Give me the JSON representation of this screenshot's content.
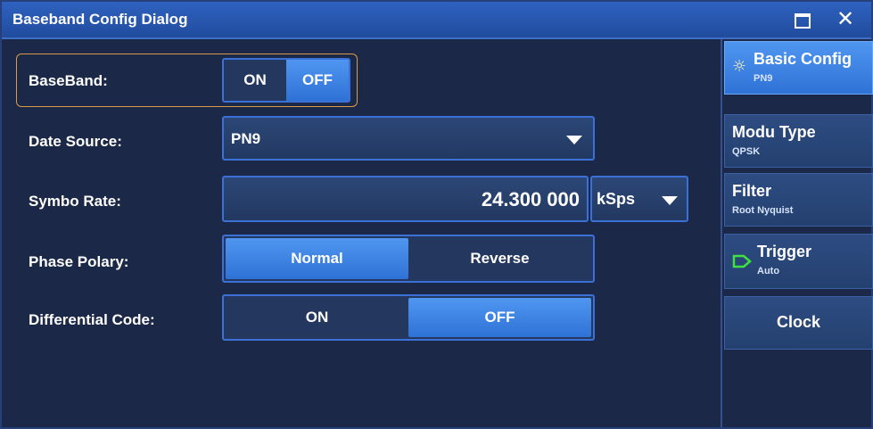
{
  "window": {
    "title": "Baseband Config Dialog"
  },
  "fields": {
    "baseband": {
      "label": "BaseBand:",
      "on": "ON",
      "off": "OFF"
    },
    "data_source": {
      "label": "Date Source:",
      "value": "PN9"
    },
    "symbol_rate": {
      "label": "Symbo Rate:",
      "value": "24.300 000",
      "unit": "kSps"
    },
    "phase_polarity": {
      "label": "Phase Polary:",
      "normal": "Normal",
      "reverse": "Reverse"
    },
    "differential_code": {
      "label": "Differential Code:",
      "on": "ON",
      "off": "OFF"
    }
  },
  "sidebar": {
    "items": [
      {
        "title": "Basic Config",
        "sub": "PN9"
      },
      {
        "title": "Modu Type",
        "sub": "QPSK"
      },
      {
        "title": "Filter",
        "sub": "Root Nyquist"
      },
      {
        "title": "Trigger",
        "sub": "Auto"
      },
      {
        "title": "Clock"
      }
    ]
  },
  "colors": {
    "accent": "#3b71d6",
    "active": "#4f96f0",
    "panel": "#1b2847",
    "titlebar": "#2e62c0",
    "focus_border": "#d99a4a"
  }
}
